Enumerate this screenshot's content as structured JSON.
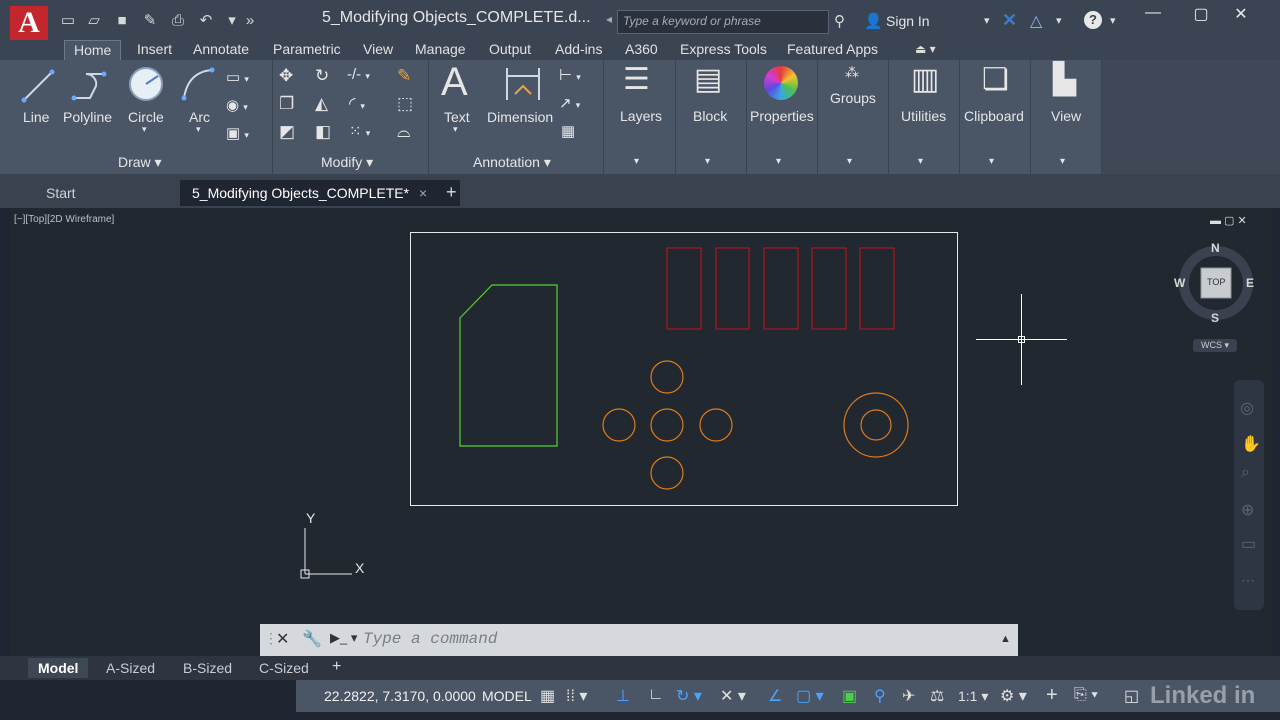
{
  "title_bar": {
    "logo": "A",
    "title": "5_Modifying Objects_COMPLETE.d...",
    "search_placeholder": "Type a keyword or phrase",
    "sign_in": "Sign In",
    "quick_access_icons": [
      "new-icon",
      "open-icon",
      "save-icon",
      "saveas-icon",
      "print-icon",
      "undo-icon",
      "redo-icon"
    ]
  },
  "ribbon_tabs": [
    "Home",
    "Insert",
    "Annotate",
    "Parametric",
    "View",
    "Manage",
    "Output",
    "Add-ins",
    "A360",
    "Express Tools",
    "Featured Apps"
  ],
  "active_tab": "Home",
  "panels": {
    "draw": {
      "title": "Draw",
      "tools": [
        "Line",
        "Polyline",
        "Circle",
        "Arc"
      ]
    },
    "modify": {
      "title": "Modify"
    },
    "annotation": {
      "title": "Annotation",
      "tools": [
        "Text",
        "Dimension"
      ]
    },
    "big_buttons": [
      "Layers",
      "Block",
      "Properties",
      "Groups",
      "Utilities",
      "Clipboard",
      "View"
    ]
  },
  "file_tabs": {
    "start": "Start",
    "active": "5_Modifying Objects_COMPLETE*",
    "close": "×",
    "add": "+"
  },
  "viewport": {
    "label": "[−][Top][2D Wireframe]",
    "compass": {
      "n": "N",
      "s": "S",
      "e": "E",
      "w": "W",
      "cube": "TOP",
      "wcs": "WCS"
    },
    "ucs": {
      "x": "X",
      "y": "Y"
    }
  },
  "command_line": {
    "placeholder": "Type a command"
  },
  "layout_tabs": [
    "Model",
    "A-Sized",
    "B-Sized",
    "C-Sized"
  ],
  "active_layout": "Model",
  "status": {
    "coords": "22.2822, 7.3170, 0.0000",
    "model": "MODEL",
    "scale": "1:1"
  },
  "watermark": "Linked in",
  "colors": {
    "green": "#55d233",
    "red": "#b3141c",
    "orange": "#e07a1c",
    "border": "#e8e8e8"
  }
}
